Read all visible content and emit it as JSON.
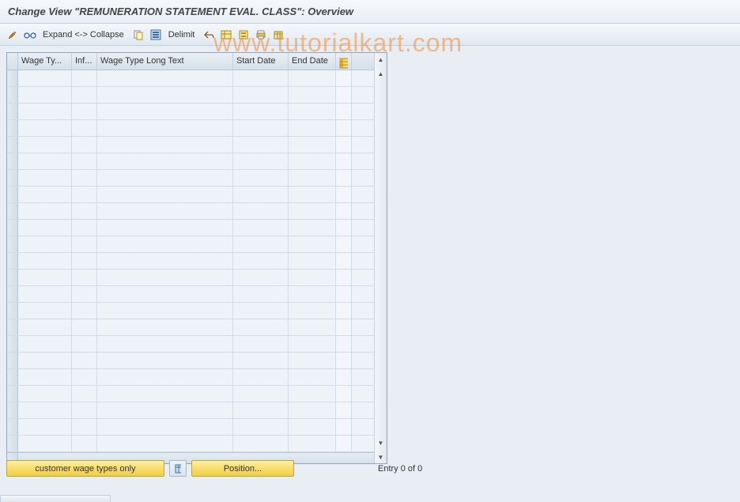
{
  "title": "Change View \"REMUNERATION STATEMENT EVAL. CLASS\": Overview",
  "watermark": "www.tutorialkart.com",
  "toolbar": {
    "expand_collapse_label": "Expand <-> Collapse",
    "delimit_label": "Delimit"
  },
  "columns": {
    "wage_type": "Wage Ty...",
    "inf": "Inf...",
    "long_text": "Wage Type Long Text",
    "start_date": "Start Date",
    "end_date": "End Date"
  },
  "rows": [
    {},
    {},
    {},
    {},
    {},
    {},
    {},
    {},
    {},
    {},
    {},
    {},
    {},
    {},
    {},
    {},
    {},
    {},
    {},
    {},
    {},
    {},
    {}
  ],
  "buttons": {
    "customer_only": "customer wage types only",
    "position": "Position..."
  },
  "footer": {
    "entry_text": "Entry 0 of 0"
  }
}
